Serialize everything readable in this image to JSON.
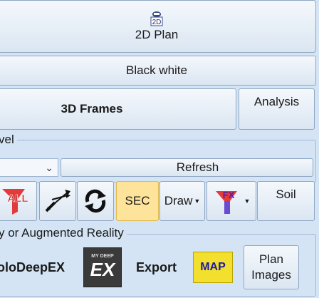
{
  "top": {
    "plan2d": {
      "icon_text": "2D",
      "label": "2D Plan"
    },
    "black_white": "Black white",
    "frames3d": "3D Frames",
    "analysis": "Analysis"
  },
  "level_group": {
    "label": "vel",
    "combo_value": "",
    "refresh": "Refresh"
  },
  "tools": {
    "all": "ALL",
    "sec": "SEC",
    "draw": "Draw",
    "fx": "FX",
    "soil": "Soil"
  },
  "ar_group": {
    "label": "y or Augmented Reality",
    "holodeep": "oloDeepEX",
    "export_icon_caption": "MY DEEP",
    "export_icon_text": "EX",
    "export": "Export",
    "map": "MAP",
    "plan_images_line1": "Plan",
    "plan_images_line2": "Images"
  }
}
